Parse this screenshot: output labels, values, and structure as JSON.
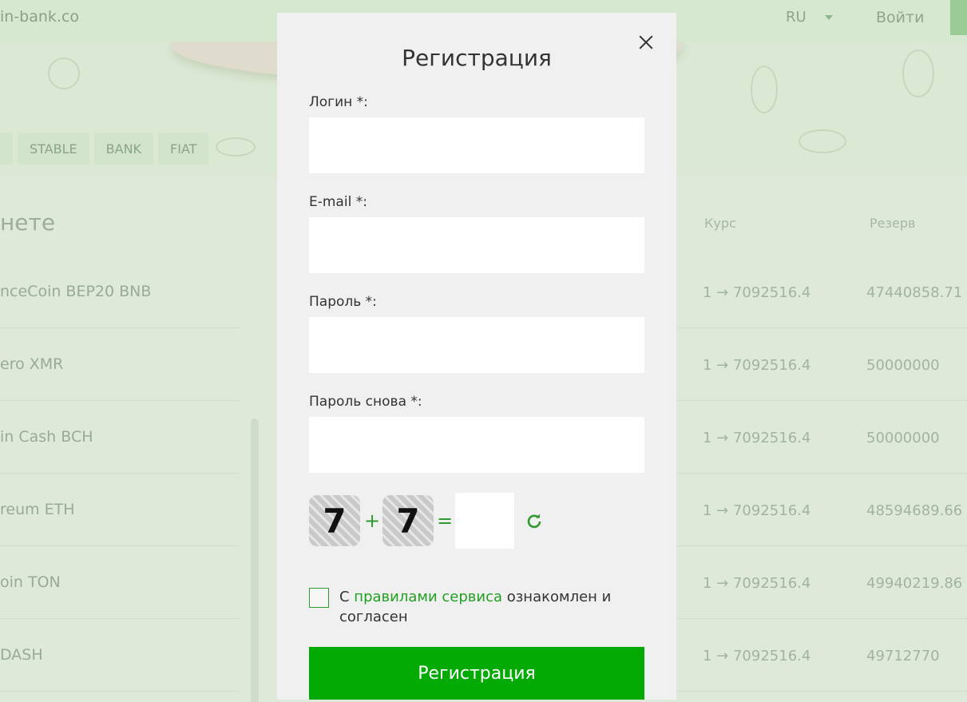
{
  "header": {
    "site_name": "in-bank.co",
    "lang": "RU",
    "login": "Войти"
  },
  "filters": [
    "STABLE",
    "BANK",
    "FIAT"
  ],
  "left_column": {
    "title": "нете",
    "items": [
      "nceCoin BEP20 BNB",
      "ero XMR",
      "in Cash BCH",
      "reum ETH",
      "oin TON",
      "DASH"
    ]
  },
  "right_column": {
    "rate_header": "Курс",
    "reserve_header": "Резерв",
    "rows": [
      {
        "rate": "1 → 7092516.4",
        "reserve": "47440858.71"
      },
      {
        "rate": "1 → 7092516.4",
        "reserve": "50000000"
      },
      {
        "rate": "1 → 7092516.4",
        "reserve": "50000000"
      },
      {
        "rate": "1 → 7092516.4",
        "reserve": "48594689.66"
      },
      {
        "rate": "1 → 7092516.4",
        "reserve": "49940219.86"
      },
      {
        "rate": "1 → 7092516.4",
        "reserve": "49712770"
      }
    ]
  },
  "modal": {
    "title": "Регистрация",
    "fields": {
      "login_label": "Логин *:",
      "login_value": "",
      "email_label": "E-mail *:",
      "email_value": "",
      "password_label": "Пароль *:",
      "password_value": "",
      "password2_label": "Пароль снова *:",
      "password2_value": ""
    },
    "captcha": {
      "a": "7",
      "op": "+",
      "b": "7",
      "eq": "=",
      "answer": ""
    },
    "agree": {
      "prefix": "С ",
      "link": "правилами сервиса",
      "suffix": " ознакомлен и согласен"
    },
    "submit": "Регистрация"
  },
  "colors": {
    "accent": "#04aa04",
    "link": "#21a021"
  }
}
